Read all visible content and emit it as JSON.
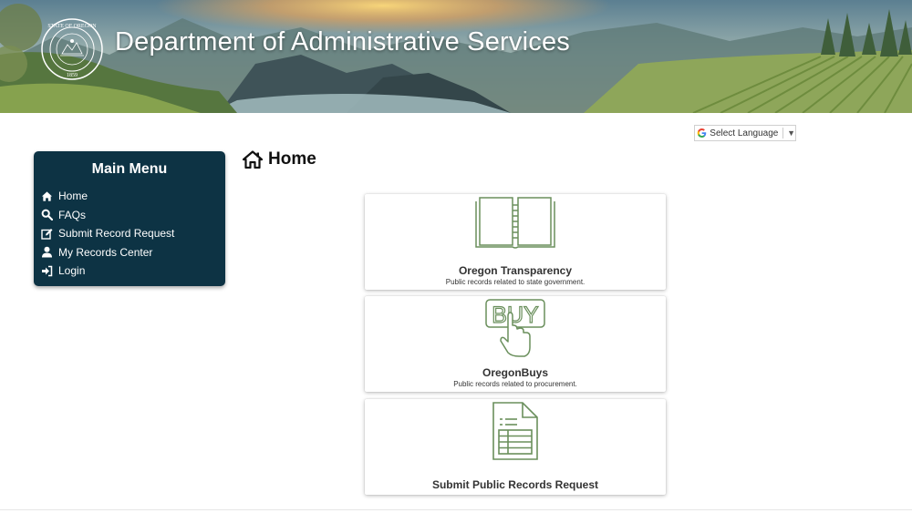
{
  "header": {
    "title": "Department of Administrative Services",
    "seal_text_top": "STATE OF OREGON",
    "seal_year": "1859"
  },
  "language": {
    "label": "Select Language",
    "caret": "▼"
  },
  "sidebar": {
    "title": "Main Menu",
    "items": [
      {
        "label": "Home",
        "icon": "home-icon"
      },
      {
        "label": "FAQs",
        "icon": "search-icon"
      },
      {
        "label": "Submit Record Request",
        "icon": "edit-icon"
      },
      {
        "label": "My Records Center",
        "icon": "user-icon"
      },
      {
        "label": "Login",
        "icon": "sign-in-icon"
      }
    ]
  },
  "main": {
    "heading": "Home",
    "cards": [
      {
        "title": "Oregon Transparency",
        "description": "Public records related to state government.",
        "icon": "open-book-icon"
      },
      {
        "title": "OregonBuys",
        "description": "Public records related to procurement.",
        "icon": "buy-button-icon",
        "icon_text": "BUY"
      },
      {
        "title": "Submit Public Records Request",
        "description": "",
        "icon": "document-form-icon"
      }
    ]
  },
  "colors": {
    "sidebar_bg": "#0d3344",
    "icon_green": "#6a8f5c",
    "banner_text": "#ffffff"
  }
}
